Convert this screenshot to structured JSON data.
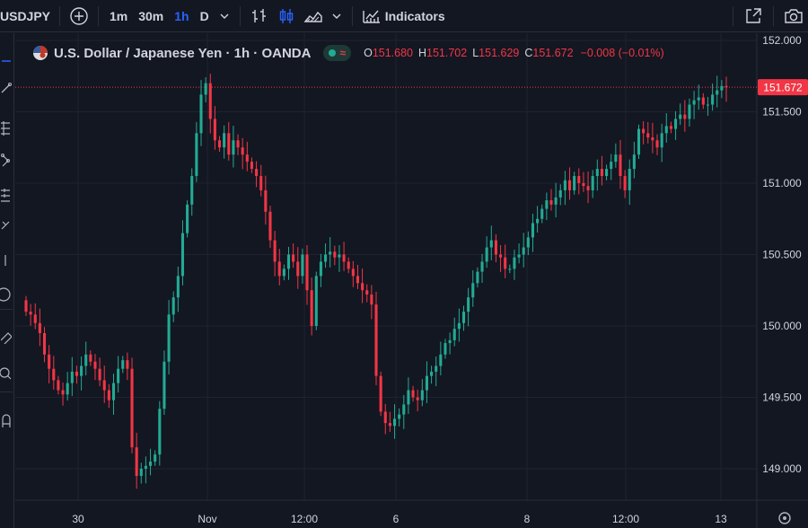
{
  "toolbar": {
    "symbol": "USDJPY",
    "timeframes": [
      "1m",
      "30m",
      "1h",
      "D"
    ],
    "active_timeframe": "1h",
    "indicators_label": "Indicators",
    "icons": [
      "add-symbol-icon",
      "chevron-down-icon",
      "bar-style-icon",
      "candles-icon",
      "area-chart-icon",
      "chevron-down-icon",
      "indicators-icon",
      "fullscreen-icon",
      "camera-icon"
    ]
  },
  "legend": {
    "flag": "us-jp-flag",
    "title": "U.S. Dollar / Japanese Yen · 1h · OANDA",
    "o_label": "O",
    "o_value": "151.680",
    "h_label": "H",
    "h_value": "151.702",
    "l_label": "L",
    "l_value": "151.629",
    "c_label": "C",
    "c_value": "151.672",
    "change": "−0.008 (−0.01%)",
    "status_wave": "≈"
  },
  "price_axis": {
    "labels": [
      "152.000",
      "151.500",
      "151.000",
      "150.500",
      "150.000",
      "149.500",
      "149.000"
    ],
    "last_price": "151.672"
  },
  "time_axis": {
    "labels": [
      "30",
      "Nov",
      "12:00",
      "6",
      "8",
      "12:00",
      "13"
    ]
  },
  "colors": {
    "background": "#131722",
    "up": "#22ab94",
    "down": "#f23645",
    "grid": "#1f2330",
    "text": "#d1d4dc",
    "accent": "#2962ff"
  },
  "chart_data": {
    "type": "candlestick",
    "ylim": [
      148.78,
      152.05
    ],
    "y_ticks": [
      152.0,
      151.5,
      151.0,
      150.5,
      150.0,
      149.5,
      149.0
    ],
    "last_price": 151.672,
    "closes": [
      150.1,
      150.08,
      150.02,
      149.95,
      149.8,
      149.7,
      149.62,
      149.55,
      149.52,
      149.6,
      149.68,
      149.65,
      149.72,
      149.8,
      149.75,
      149.7,
      149.62,
      149.55,
      149.48,
      149.6,
      149.7,
      149.76,
      149.7,
      149.15,
      148.95,
      149.0,
      149.02,
      149.05,
      149.1,
      149.42,
      149.75,
      150.08,
      150.2,
      150.35,
      150.65,
      150.85,
      151.05,
      151.35,
      151.62,
      151.7,
      151.45,
      151.3,
      151.25,
      151.35,
      151.2,
      151.3,
      151.25,
      151.2,
      151.15,
      151.1,
      151.05,
      150.95,
      150.8,
      150.6,
      150.45,
      150.35,
      150.4,
      150.5,
      150.45,
      150.35,
      150.5,
      150.25,
      150.0,
      150.35,
      150.45,
      150.5,
      150.52,
      150.48,
      150.5,
      150.45,
      150.4,
      150.35,
      150.3,
      150.25,
      150.22,
      150.15,
      149.65,
      149.4,
      149.32,
      149.3,
      149.35,
      149.38,
      149.45,
      149.55,
      149.5,
      149.48,
      149.55,
      149.65,
      149.68,
      149.72,
      149.8,
      149.88,
      149.9,
      149.98,
      150.02,
      150.1,
      150.2,
      150.3,
      150.38,
      150.45,
      150.55,
      150.6,
      150.5,
      150.48,
      150.4,
      150.4,
      150.48,
      150.5,
      150.55,
      150.62,
      150.72,
      150.75,
      150.82,
      150.88,
      150.85,
      150.9,
      150.95,
      151.02,
      150.95,
      151.05,
      151.0,
      150.98,
      150.95,
      151.05,
      151.1,
      151.05,
      151.1,
      151.15,
      151.2,
      151.05,
      150.95,
      151.1,
      151.2,
      151.38,
      151.35,
      151.32,
      151.3,
      151.25,
      151.35,
      151.4,
      151.38,
      151.45,
      151.48,
      151.45,
      151.55,
      151.58,
      151.6,
      151.55,
      151.55,
      151.62,
      151.65,
      151.68,
      151.672
    ]
  }
}
